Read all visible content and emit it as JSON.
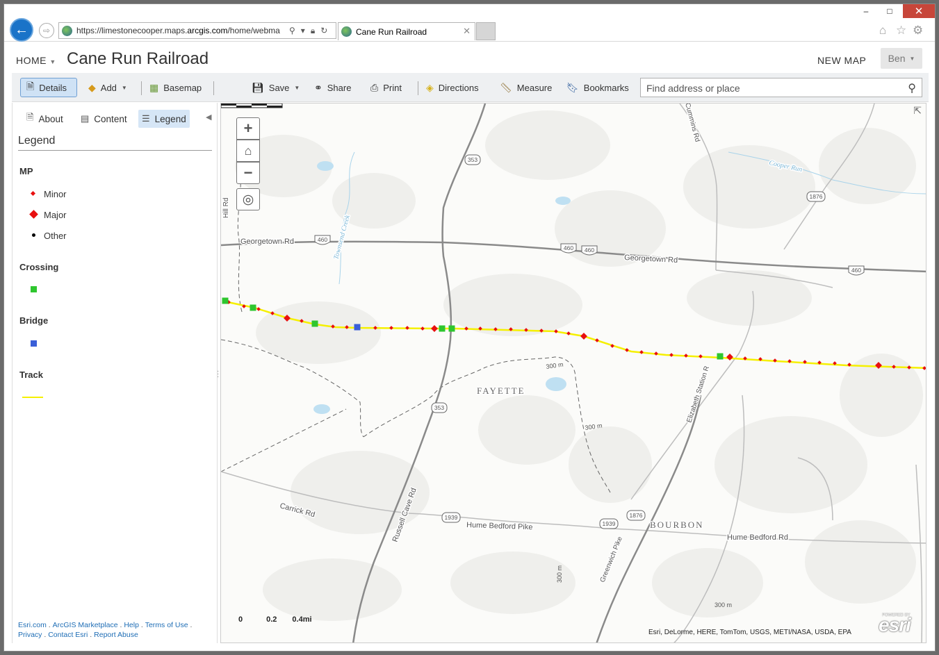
{
  "browser": {
    "url_prefix": "https://limestonecooper.maps.",
    "url_domain": "arcgis.com",
    "url_suffix": "/home/webma",
    "tab_title": "Cane Run Railroad",
    "back_icon": "back-arrow-icon",
    "forward_icon": "forward-arrow-icon",
    "close_glyph": "✕",
    "max_glyph": "□",
    "min_glyph": "–"
  },
  "header": {
    "home_label": "HOME",
    "title": "Cane Run Railroad",
    "new_map_label": "NEW MAP",
    "user_label": "Ben"
  },
  "toolbar": {
    "details_label": "Details",
    "add_label": "Add",
    "basemap_label": "Basemap",
    "save_label": "Save",
    "share_label": "Share",
    "print_label": "Print",
    "directions_label": "Directions",
    "measure_label": "Measure",
    "bookmarks_label": "Bookmarks",
    "search_placeholder": "Find address or place"
  },
  "panel": {
    "tabs": [
      {
        "label": "About"
      },
      {
        "label": "Content"
      },
      {
        "label": "Legend",
        "selected": true
      }
    ],
    "legend_title": "Legend",
    "legend": {
      "mp_title": "MP",
      "mp_items": [
        {
          "label": "Minor",
          "color": "#e81010"
        },
        {
          "label": "Major",
          "color": "#e81010"
        },
        {
          "label": "Other",
          "color": "#000000"
        }
      ],
      "crossing_title": "Crossing",
      "crossing_color": "#2ec62e",
      "bridge_title": "Bridge",
      "bridge_color": "#3a5fd8",
      "track_title": "Track",
      "track_color": "#f5f000"
    },
    "footer": {
      "links": [
        "Esri.com",
        "ArcGIS Marketplace",
        "Help",
        "Terms of Use",
        "Privacy",
        "Contact Esri",
        "Report Abuse"
      ]
    }
  },
  "map": {
    "labels": {
      "georgetown_rd_w": "Georgetown Rd",
      "georgetown_rd_e": "Georgetown Rd",
      "hill_rd": "Hill Rd",
      "townsend_creek": "Townsend Creek",
      "cummins_rd": "Cummins Rd",
      "cooper_run": "Cooper Run",
      "fayette": "FAYETTE",
      "bourbon": "BOURBON",
      "elizabeth_station": "Elizabeth Station R",
      "carrick_rd": "Carrick Rd",
      "russell_cave_rd": "Russell Cave Rd",
      "hume_bedford_w": "Hume Bedford Pike",
      "hume_bedford_e": "Hume Bedford Rd",
      "greenwich_pike": "Greenwich Pike",
      "contour_300": "300 m"
    },
    "shields": {
      "r353": "353",
      "r460": "460",
      "r1876": "1876",
      "r1939": "1939"
    },
    "scale_labels": [
      "0",
      "0.2",
      "0.4mi"
    ],
    "attribution": "Esri, DeLorme, HERE, TomTom, USGS, METI/NASA, USDA, EPA",
    "powered_by": "POWERED BY",
    "esri_logo": "esri",
    "zoom_in_glyph": "+",
    "zoom_out_glyph": "−",
    "home_glyph": "⌂",
    "locate_glyph": "◎",
    "expand_glyph": "⇱"
  }
}
